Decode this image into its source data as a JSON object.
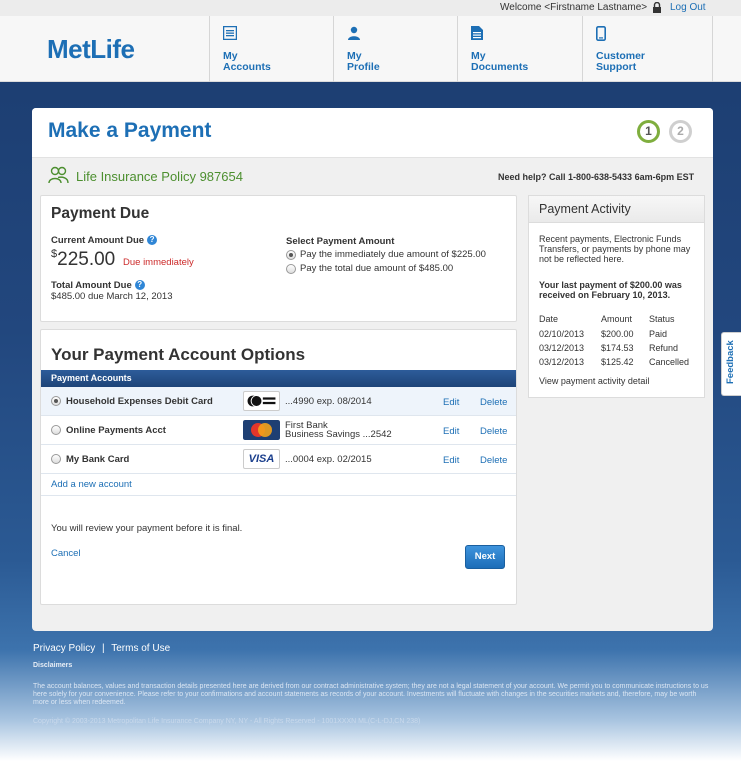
{
  "topbar": {
    "welcome": "Welcome <Firstname Lastname>",
    "logout": "Log Out"
  },
  "brand": {
    "logo": "MetLife"
  },
  "nav": [
    {
      "line1": "My",
      "line2": "Accounts",
      "icon": "list-icon"
    },
    {
      "line1": "My",
      "line2": "Profile",
      "icon": "person-icon"
    },
    {
      "line1": "My",
      "line2": "Documents",
      "icon": "document-icon"
    },
    {
      "line1": "Customer",
      "line2": "Support",
      "icon": "mobile-icon"
    }
  ],
  "page": {
    "title": "Make a Payment",
    "steps": [
      "1",
      "2"
    ],
    "policy": "Life Insurance Policy 987654",
    "help": "Need help? Call 1-800-638-5433 6am-6pm EST"
  },
  "payment_due": {
    "heading": "Payment Due",
    "current_label": "Current Amount Due",
    "currency": "$",
    "current_amount": "225.00",
    "due_status": "Due immediately",
    "total_label": "Total Amount Due",
    "total_text": "$485.00 due March 12, 2013",
    "select_label": "Select Payment Amount",
    "options": [
      {
        "label": "Pay the immediately due amount of $225.00",
        "selected": true
      },
      {
        "label": "Pay the total due amount of $485.00",
        "selected": false
      }
    ]
  },
  "accounts": {
    "heading": "Your Payment Account Options",
    "bar_label": "Payment Accounts",
    "items": [
      {
        "name": "Household Expenses Debit Card",
        "card": "ACCEL DEBIT",
        "detail1": "...4990  exp. 08/2014",
        "detail2": "",
        "selected": true
      },
      {
        "name": "Online Payments Acct",
        "card": "MasterCard",
        "detail1": "First Bank",
        "detail2": "Business Savings ...2542",
        "selected": false
      },
      {
        "name": "My Bank Card",
        "card": "VISA",
        "detail1": "...0004  exp. 02/2015",
        "detail2": "",
        "selected": false
      }
    ],
    "edit_label": "Edit",
    "delete_label": "Delete",
    "add_label": "Add a new account",
    "review_note": "You will review your payment before it is final.",
    "cancel_label": "Cancel",
    "next_label": "Next"
  },
  "activity": {
    "heading": "Payment Activity",
    "note": "Recent payments, Electronic Funds Transfers, or payments by phone may not be reflected here.",
    "last_payment": "Your last payment of $200.00 was received on February 10, 2013.",
    "columns": [
      "Date",
      "Amount",
      "Status"
    ],
    "rows": [
      [
        "02/10/2013",
        "$200.00",
        "Paid"
      ],
      [
        "03/12/2013",
        "$174.53",
        "Refund"
      ],
      [
        "03/12/2013",
        "$125.42",
        "Cancelled"
      ]
    ],
    "detail_link": "View payment activity detail"
  },
  "feedback": "Feedback",
  "footer": {
    "privacy": "Privacy Policy",
    "separator": "|",
    "terms": "Terms of Use",
    "disclaimers": "Disclaimers",
    "disclaimer_text": "The account balances, values and transaction details presented here are derived from our contract administrative system; they are not a legal statement of your account. We permit you to communicate instructions to us here solely for your convenience. Please refer to your confirmations and account statements as records of your account. Investments will fluctuate with changes in the securities markets and, therefore, may be worth more or less when redeemed.",
    "copyright": "Copyright © 2003-2013 Metropolitan Life Insurance Company NY, NY - All Rights Reserved - 1001XXXN ML(C-L-DJ,CN 238)"
  },
  "colors": {
    "brand_blue": "#1d6fb5",
    "green": "#4c8f2f",
    "alert_red": "#cc2a2a",
    "nav_bar": "#1e4478"
  }
}
